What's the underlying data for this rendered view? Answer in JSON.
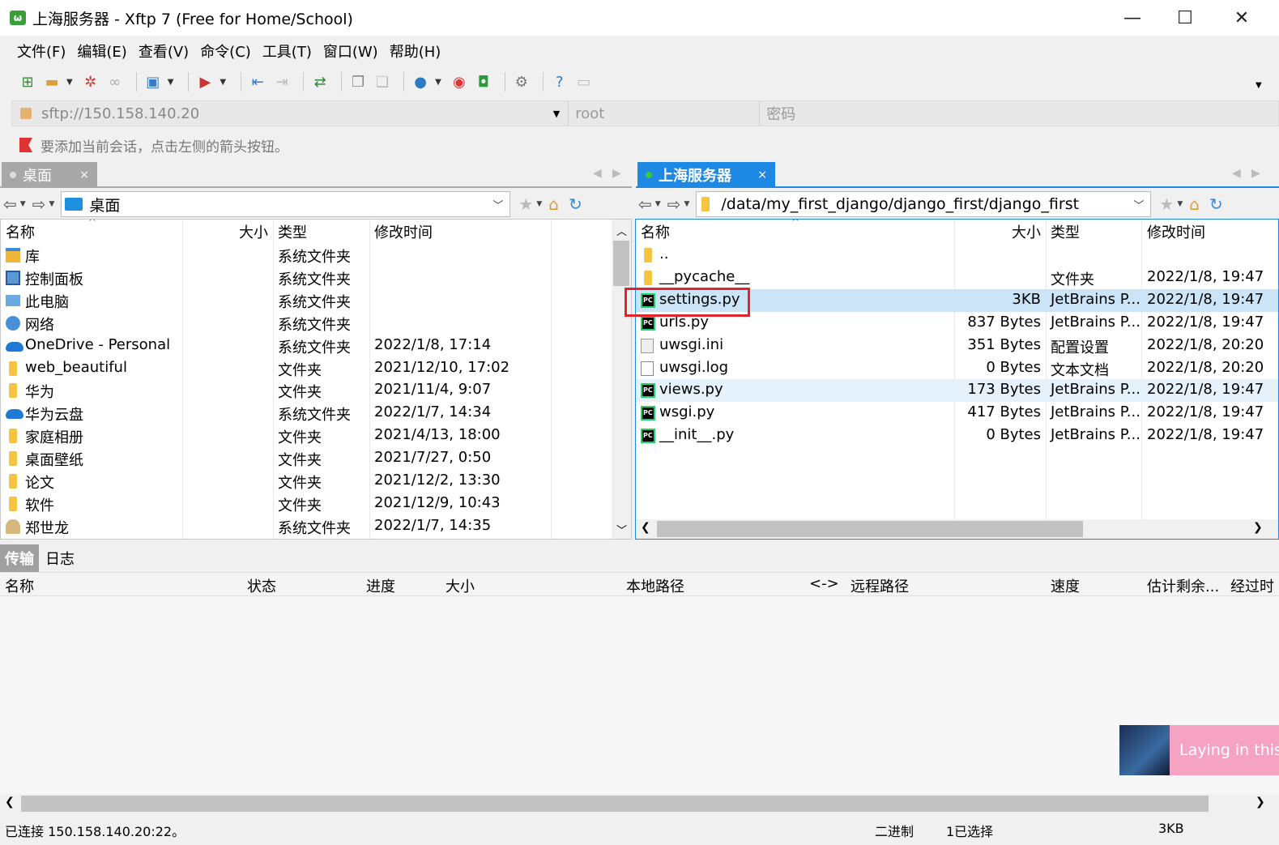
{
  "window": {
    "title": "上海服务器 - Xftp 7 (Free for Home/School)",
    "minimize": "—",
    "maximize": "☐",
    "close": "✕"
  },
  "menu": [
    "文件(F)",
    "编辑(E)",
    "查看(V)",
    "命令(C)",
    "工具(T)",
    "窗口(W)",
    "帮助(H)"
  ],
  "address": {
    "url": "sftp://150.158.140.20",
    "user_placeholder": "root",
    "password_placeholder": "密码"
  },
  "hint": "要添加当前会话，点击左侧的箭头按钮。",
  "left_tab": {
    "label": "桌面",
    "close": "×"
  },
  "right_tab": {
    "label": "上海服务器",
    "close": "×"
  },
  "left_path": "桌面",
  "right_path": "/data/my_first_django/django_first/django_first",
  "columns": {
    "name": "名称",
    "size": "大小",
    "type": "类型",
    "modified": "修改时间"
  },
  "left_files": [
    {
      "name": "库",
      "size": "",
      "type": "系统文件夹",
      "modified": "",
      "icon": "library-icon"
    },
    {
      "name": "控制面板",
      "size": "",
      "type": "系统文件夹",
      "modified": "",
      "icon": "control-panel-icon"
    },
    {
      "name": "此电脑",
      "size": "",
      "type": "系统文件夹",
      "modified": "",
      "icon": "computer-icon"
    },
    {
      "name": "网络",
      "size": "",
      "type": "系统文件夹",
      "modified": "",
      "icon": "network-icon"
    },
    {
      "name": "OneDrive - Personal",
      "size": "",
      "type": "系统文件夹",
      "modified": "2022/1/8, 17:14",
      "icon": "cloud-icon"
    },
    {
      "name": "web_beautiful",
      "size": "",
      "type": "文件夹",
      "modified": "2021/12/10, 17:02",
      "icon": "folder-icon"
    },
    {
      "name": "华为",
      "size": "",
      "type": "文件夹",
      "modified": "2021/11/4, 9:07",
      "icon": "folder-icon"
    },
    {
      "name": "华为云盘",
      "size": "",
      "type": "系统文件夹",
      "modified": "2022/1/7, 14:34",
      "icon": "cloud-icon"
    },
    {
      "name": "家庭相册",
      "size": "",
      "type": "文件夹",
      "modified": "2021/4/13, 18:00",
      "icon": "folder-icon"
    },
    {
      "name": "桌面壁纸",
      "size": "",
      "type": "文件夹",
      "modified": "2021/7/27, 0:50",
      "icon": "folder-icon"
    },
    {
      "name": "论文",
      "size": "",
      "type": "文件夹",
      "modified": "2021/12/2, 13:30",
      "icon": "folder-icon"
    },
    {
      "name": "软件",
      "size": "",
      "type": "文件夹",
      "modified": "2021/12/9, 10:43",
      "icon": "folder-icon"
    },
    {
      "name": "郑世龙",
      "size": "",
      "type": "系统文件夹",
      "modified": "2022/1/7, 14:35",
      "icon": "user-folder-icon"
    }
  ],
  "right_files": [
    {
      "name": "..",
      "size": "",
      "type": "",
      "modified": "",
      "icon": "folder-icon"
    },
    {
      "name": "__pycache__",
      "size": "",
      "type": "文件夹",
      "modified": "2022/1/8, 19:47",
      "icon": "folder-icon"
    },
    {
      "name": "settings.py",
      "size": "3KB",
      "type": "JetBrains P...",
      "modified": "2022/1/8, 19:47",
      "icon": "pycharm-icon"
    },
    {
      "name": "urls.py",
      "size": "837 Bytes",
      "type": "JetBrains P...",
      "modified": "2022/1/8, 19:47",
      "icon": "pycharm-icon"
    },
    {
      "name": "uwsgi.ini",
      "size": "351 Bytes",
      "type": "配置设置",
      "modified": "2022/1/8, 20:20",
      "icon": "config-file-icon"
    },
    {
      "name": "uwsgi.log",
      "size": "0 Bytes",
      "type": "文本文档",
      "modified": "2022/1/8, 20:20",
      "icon": "text-file-icon"
    },
    {
      "name": "views.py",
      "size": "173 Bytes",
      "type": "JetBrains P...",
      "modified": "2022/1/8, 19:47",
      "icon": "pycharm-icon"
    },
    {
      "name": "wsgi.py",
      "size": "417 Bytes",
      "type": "JetBrains P...",
      "modified": "2022/1/8, 19:47",
      "icon": "pycharm-icon"
    },
    {
      "name": "__init__.py",
      "size": "0 Bytes",
      "type": "JetBrains P...",
      "modified": "2022/1/8, 19:47",
      "icon": "pycharm-icon"
    }
  ],
  "bottom_tabs": [
    "传输",
    "日志"
  ],
  "transfer_columns": [
    "名称",
    "状态",
    "进度",
    "大小",
    "本地路径",
    "<->",
    "远程路径",
    "速度",
    "估计剩余...",
    "经过时"
  ],
  "notification": "Laying in this",
  "status": {
    "connection": "已连接 150.158.140.20:22。",
    "mode": "二进制",
    "selected": "1已选择",
    "size": "3KB"
  },
  "colors": {
    "accent": "#1e88e5",
    "selection": "#cce4f7",
    "highlight_box": "#e0242b",
    "notification": "#f6a3c3"
  }
}
